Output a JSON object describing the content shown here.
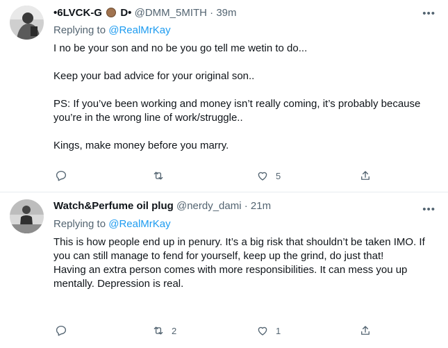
{
  "tweets": [
    {
      "display_name": "•6LVCK-G",
      "display_name_suffix": "D•",
      "handle": "@DMM_5MITH",
      "dot": "·",
      "time": "39m",
      "replying_prefix": "Replying to",
      "replying_to": "@RealMrKay",
      "paragraphs": [
        "I no be your son and no be you go tell me wetin to do...",
        "Keep your bad advice for your original son..",
        "PS: If you’ve been working and money isn’t really coming, it’s probably because you’re in the wrong line of work/struggle..",
        "Kings, make money before you marry."
      ],
      "retweets": "",
      "likes": "5"
    },
    {
      "display_name": "Watch&Perfume oil plug",
      "handle": "@nerdy_dami",
      "dot": "·",
      "time": "21m",
      "replying_prefix": "Replying to",
      "replying_to": "@RealMrKay",
      "paragraphs": [
        "This is how people end up in penury. It’s a big risk that shouldn’t be taken IMO. If you can still manage to fend for yourself, keep up the grind, do just that!",
        "Having an extra person comes with more responsibilities. It can mess you up mentally. Depression is real."
      ],
      "retweets": "2",
      "likes": "1"
    }
  ],
  "more_label": "•••",
  "colors": {
    "accent": "#1d9bf0",
    "muted": "#536471",
    "text": "#0f1419",
    "divider": "#e6ecf0"
  },
  "icons": {
    "reply": "reply-icon",
    "retweet": "retweet-icon",
    "like": "like-icon",
    "share": "share-icon"
  }
}
